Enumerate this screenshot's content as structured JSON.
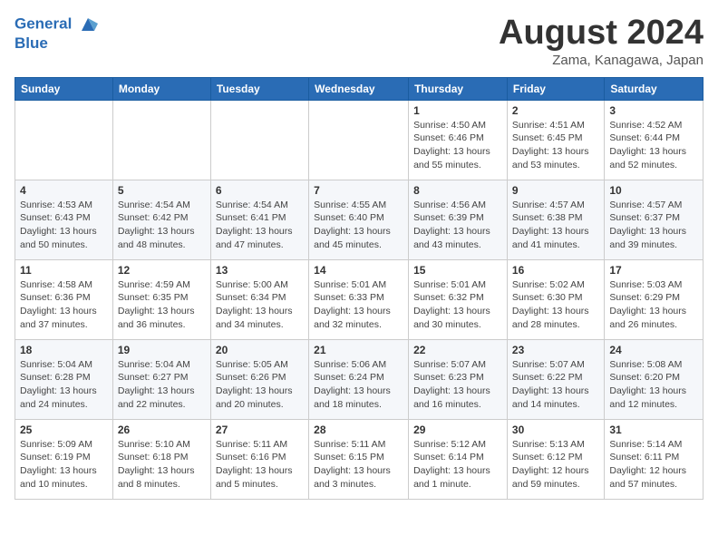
{
  "logo": {
    "line1": "General",
    "line2": "Blue"
  },
  "title": "August 2024",
  "subtitle": "Zama, Kanagawa, Japan",
  "weekdays": [
    "Sunday",
    "Monday",
    "Tuesday",
    "Wednesday",
    "Thursday",
    "Friday",
    "Saturday"
  ],
  "weeks": [
    [
      {
        "day": "",
        "info": ""
      },
      {
        "day": "",
        "info": ""
      },
      {
        "day": "",
        "info": ""
      },
      {
        "day": "",
        "info": ""
      },
      {
        "day": "1",
        "info": "Sunrise: 4:50 AM\nSunset: 6:46 PM\nDaylight: 13 hours\nand 55 minutes."
      },
      {
        "day": "2",
        "info": "Sunrise: 4:51 AM\nSunset: 6:45 PM\nDaylight: 13 hours\nand 53 minutes."
      },
      {
        "day": "3",
        "info": "Sunrise: 4:52 AM\nSunset: 6:44 PM\nDaylight: 13 hours\nand 52 minutes."
      }
    ],
    [
      {
        "day": "4",
        "info": "Sunrise: 4:53 AM\nSunset: 6:43 PM\nDaylight: 13 hours\nand 50 minutes."
      },
      {
        "day": "5",
        "info": "Sunrise: 4:54 AM\nSunset: 6:42 PM\nDaylight: 13 hours\nand 48 minutes."
      },
      {
        "day": "6",
        "info": "Sunrise: 4:54 AM\nSunset: 6:41 PM\nDaylight: 13 hours\nand 47 minutes."
      },
      {
        "day": "7",
        "info": "Sunrise: 4:55 AM\nSunset: 6:40 PM\nDaylight: 13 hours\nand 45 minutes."
      },
      {
        "day": "8",
        "info": "Sunrise: 4:56 AM\nSunset: 6:39 PM\nDaylight: 13 hours\nand 43 minutes."
      },
      {
        "day": "9",
        "info": "Sunrise: 4:57 AM\nSunset: 6:38 PM\nDaylight: 13 hours\nand 41 minutes."
      },
      {
        "day": "10",
        "info": "Sunrise: 4:57 AM\nSunset: 6:37 PM\nDaylight: 13 hours\nand 39 minutes."
      }
    ],
    [
      {
        "day": "11",
        "info": "Sunrise: 4:58 AM\nSunset: 6:36 PM\nDaylight: 13 hours\nand 37 minutes."
      },
      {
        "day": "12",
        "info": "Sunrise: 4:59 AM\nSunset: 6:35 PM\nDaylight: 13 hours\nand 36 minutes."
      },
      {
        "day": "13",
        "info": "Sunrise: 5:00 AM\nSunset: 6:34 PM\nDaylight: 13 hours\nand 34 minutes."
      },
      {
        "day": "14",
        "info": "Sunrise: 5:01 AM\nSunset: 6:33 PM\nDaylight: 13 hours\nand 32 minutes."
      },
      {
        "day": "15",
        "info": "Sunrise: 5:01 AM\nSunset: 6:32 PM\nDaylight: 13 hours\nand 30 minutes."
      },
      {
        "day": "16",
        "info": "Sunrise: 5:02 AM\nSunset: 6:30 PM\nDaylight: 13 hours\nand 28 minutes."
      },
      {
        "day": "17",
        "info": "Sunrise: 5:03 AM\nSunset: 6:29 PM\nDaylight: 13 hours\nand 26 minutes."
      }
    ],
    [
      {
        "day": "18",
        "info": "Sunrise: 5:04 AM\nSunset: 6:28 PM\nDaylight: 13 hours\nand 24 minutes."
      },
      {
        "day": "19",
        "info": "Sunrise: 5:04 AM\nSunset: 6:27 PM\nDaylight: 13 hours\nand 22 minutes."
      },
      {
        "day": "20",
        "info": "Sunrise: 5:05 AM\nSunset: 6:26 PM\nDaylight: 13 hours\nand 20 minutes."
      },
      {
        "day": "21",
        "info": "Sunrise: 5:06 AM\nSunset: 6:24 PM\nDaylight: 13 hours\nand 18 minutes."
      },
      {
        "day": "22",
        "info": "Sunrise: 5:07 AM\nSunset: 6:23 PM\nDaylight: 13 hours\nand 16 minutes."
      },
      {
        "day": "23",
        "info": "Sunrise: 5:07 AM\nSunset: 6:22 PM\nDaylight: 13 hours\nand 14 minutes."
      },
      {
        "day": "24",
        "info": "Sunrise: 5:08 AM\nSunset: 6:20 PM\nDaylight: 13 hours\nand 12 minutes."
      }
    ],
    [
      {
        "day": "25",
        "info": "Sunrise: 5:09 AM\nSunset: 6:19 PM\nDaylight: 13 hours\nand 10 minutes."
      },
      {
        "day": "26",
        "info": "Sunrise: 5:10 AM\nSunset: 6:18 PM\nDaylight: 13 hours\nand 8 minutes."
      },
      {
        "day": "27",
        "info": "Sunrise: 5:11 AM\nSunset: 6:16 PM\nDaylight: 13 hours\nand 5 minutes."
      },
      {
        "day": "28",
        "info": "Sunrise: 5:11 AM\nSunset: 6:15 PM\nDaylight: 13 hours\nand 3 minutes."
      },
      {
        "day": "29",
        "info": "Sunrise: 5:12 AM\nSunset: 6:14 PM\nDaylight: 13 hours\nand 1 minute."
      },
      {
        "day": "30",
        "info": "Sunrise: 5:13 AM\nSunset: 6:12 PM\nDaylight: 12 hours\nand 59 minutes."
      },
      {
        "day": "31",
        "info": "Sunrise: 5:14 AM\nSunset: 6:11 PM\nDaylight: 12 hours\nand 57 minutes."
      }
    ]
  ]
}
